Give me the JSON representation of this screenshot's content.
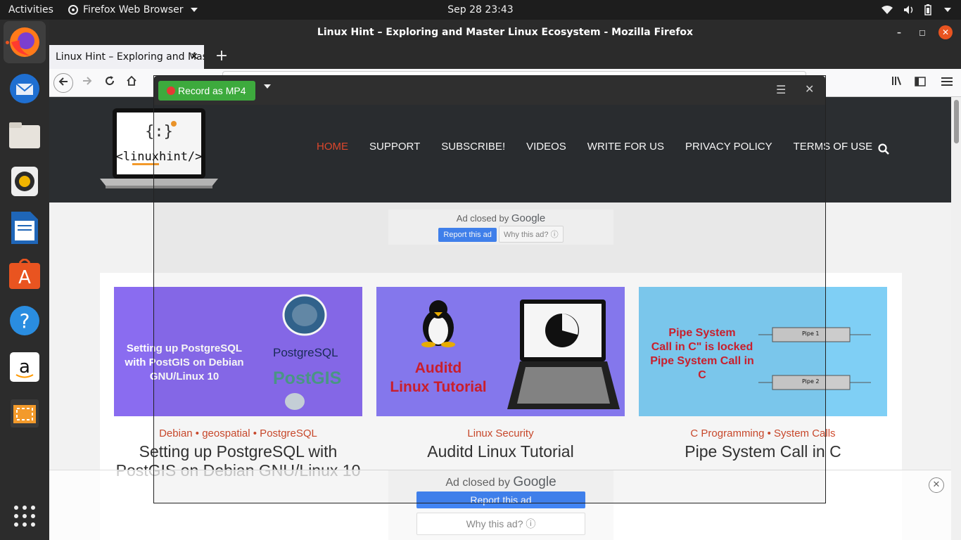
{
  "topbar": {
    "activities": "Activities",
    "app_name": "Firefox Web Browser",
    "clock": "Sep 28  23:43"
  },
  "window": {
    "title": "Linux Hint – Exploring and Master Linux Ecosystem - Mozilla Firefox",
    "tab_title": "Linux Hint – Exploring and Master Linux Ecosystem"
  },
  "recorder": {
    "record_label": "Record as MP4"
  },
  "site": {
    "nav": [
      "HOME",
      "SUPPORT",
      "SUBSCRIBE!",
      "VIDEOS",
      "WRITE FOR US",
      "PRIVACY POLICY",
      "TERMS OF USE"
    ],
    "ad_top": {
      "closed_by": "Ad closed by",
      "brand": "Google",
      "report": "Report this ad",
      "why": "Why this ad? ⓘ"
    },
    "ad_bottom": {
      "closed_by": "Ad closed by",
      "brand": "Google",
      "report": "Report this ad",
      "why": "Why this ad? ⓘ"
    },
    "cards": [
      {
        "image_text": "Setting up PostgreSQL with PostGIS on Debian GNU/Linux 10",
        "image_logo1": "PostgreSQL",
        "image_logo2": "PostGIS",
        "cats": "Debian • geospatial • PostgreSQL",
        "title": "Setting up PostgreSQL with PostGIS on Debian GNU/Linux 10"
      },
      {
        "image_text_1": "Auditd",
        "image_text_2": "Linux Tutorial",
        "cats": "Linux Security",
        "title": "Auditd Linux Tutorial"
      },
      {
        "image_text_1": "Pipe System",
        "image_text_2": "Call in C\" is locked",
        "image_text_3": "Pipe System Call in C",
        "image_pipe1": "Pipe 1",
        "image_pipe2": "Pipe 2",
        "cats": "C Programming • System Calls",
        "title": "Pipe System Call in C"
      }
    ]
  },
  "colors": {
    "accent": "#e64a2e",
    "header_bg": "#2b2e31",
    "record_green": "#3daa3d",
    "report_blue": "#4285f4"
  }
}
